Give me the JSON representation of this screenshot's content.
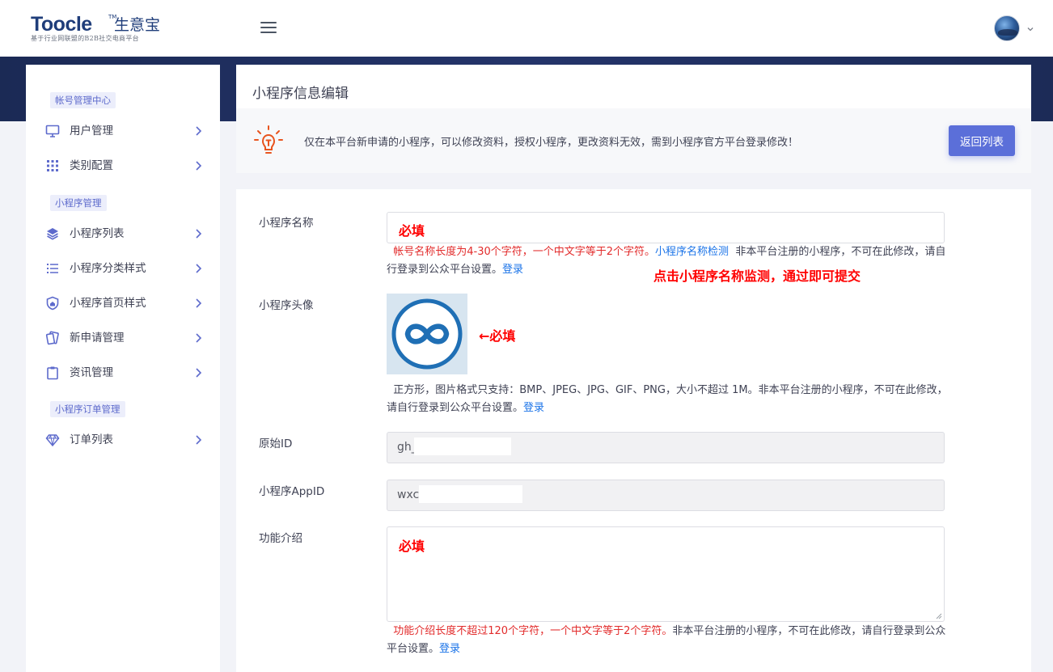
{
  "header": {
    "logo_text": "Toocle",
    "logo_tm": "TM",
    "logo_cn": "生意宝",
    "logo_subtitle": "基于行业网联盟的B2B社交电商平台",
    "icons": [
      "menu-icon",
      "avatar",
      "chevron-down-icon"
    ]
  },
  "sidebar": {
    "sections": [
      {
        "title": "帐号管理中心",
        "items": [
          {
            "label": "用户管理",
            "icon": "monitor-icon"
          },
          {
            "label": "类别配置",
            "icon": "grid-icon"
          }
        ]
      },
      {
        "title": "小程序管理",
        "items": [
          {
            "label": "小程序列表",
            "icon": "layers-icon"
          },
          {
            "label": "小程序分类样式",
            "icon": "list-icon"
          },
          {
            "label": "小程序首页样式",
            "icon": "shield-home-icon"
          },
          {
            "label": "新申请管理",
            "icon": "cards-icon"
          },
          {
            "label": "资讯管理",
            "icon": "clipboard-icon"
          }
        ]
      },
      {
        "title": "小程序订单管理",
        "items": [
          {
            "label": "订单列表",
            "icon": "diamond-icon"
          }
        ]
      }
    ]
  },
  "page": {
    "title": "小程序信息编辑",
    "notice": "仅在本平台新申请的小程序，可以修改资料，授权小程序，更改资料无效，需到小程序官方平台登录修改！",
    "back_button": "返回列表"
  },
  "form": {
    "name": {
      "label": "小程序名称",
      "value": "必填",
      "hint_red": "帐号名称长度为4-30个字符，一个中文字等于2个字符。",
      "hint_link": "小程序名称检测",
      "hint_rest": "非本平台注册的小程序，不可在此修改，请自行登录到公众平台设置。",
      "login_link": "登录",
      "annotation": "点击小程序名称监测，通过即可提交"
    },
    "avatar": {
      "label": "小程序头像",
      "annotation": "←必填",
      "hint": "正方形，图片格式只支持：BMP、JPEG、JPG、GIF、PNG，大小不超过 1M。非本平台注册的小程序，不可在此修改，请自行登录到公众平台设置。",
      "login_link": "登录"
    },
    "original_id": {
      "label": "原始ID",
      "value": "gh_"
    },
    "appid": {
      "label": "小程序AppID",
      "value": "wxc"
    },
    "description": {
      "label": "功能介绍",
      "value": "必填",
      "hint_red": "功能介绍长度不超过120个字符，一个中文字等于2个字符。",
      "hint_rest": "非本平台注册的小程序，不可在此修改，请自行登录到公众平台设置。",
      "login_link": "登录"
    }
  },
  "colors": {
    "primary": "#5b6fd9",
    "banner": "#1b2a55",
    "required": "#ff0000",
    "hint_red": "#e22b2b",
    "link": "#1a73e8",
    "icon_accent": "#e8541e"
  }
}
